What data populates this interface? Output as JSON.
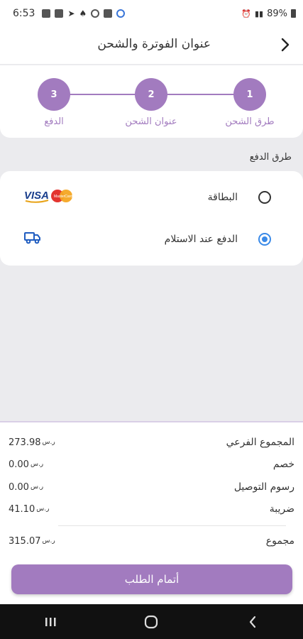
{
  "status_bar": {
    "time": "6:53",
    "battery": "89%"
  },
  "header": {
    "title": "عنوان الفوترة والشحن"
  },
  "stepper": {
    "steps": [
      {
        "number": "1",
        "label": "طرق الشحن"
      },
      {
        "number": "2",
        "label": "عنوان الشحن"
      },
      {
        "number": "3",
        "label": "الدفع"
      }
    ]
  },
  "payment": {
    "section_title": "طرق الدفع",
    "options": [
      {
        "label": "البطاقة",
        "selected": false,
        "icon": "visa-mastercard-icon"
      },
      {
        "label": "الدفع عند الاستلام",
        "selected": true,
        "icon": "truck-icon"
      }
    ]
  },
  "summary": {
    "rows": [
      {
        "label": "المجموع الفرعي",
        "value": "273.98"
      },
      {
        "label": "خصم",
        "value": "0.00"
      },
      {
        "label": "رسوم التوصيل",
        "value": "0.00"
      },
      {
        "label": "ضريبة",
        "value": "41.10"
      }
    ],
    "total": {
      "label": "مجموع",
      "value": "315.07"
    },
    "currency_symbol": "ر.س"
  },
  "checkout_button": {
    "label": "أتمام الطلب"
  },
  "colors": {
    "accent": "#a27bbf",
    "radio_selected": "#3a8ae8"
  }
}
